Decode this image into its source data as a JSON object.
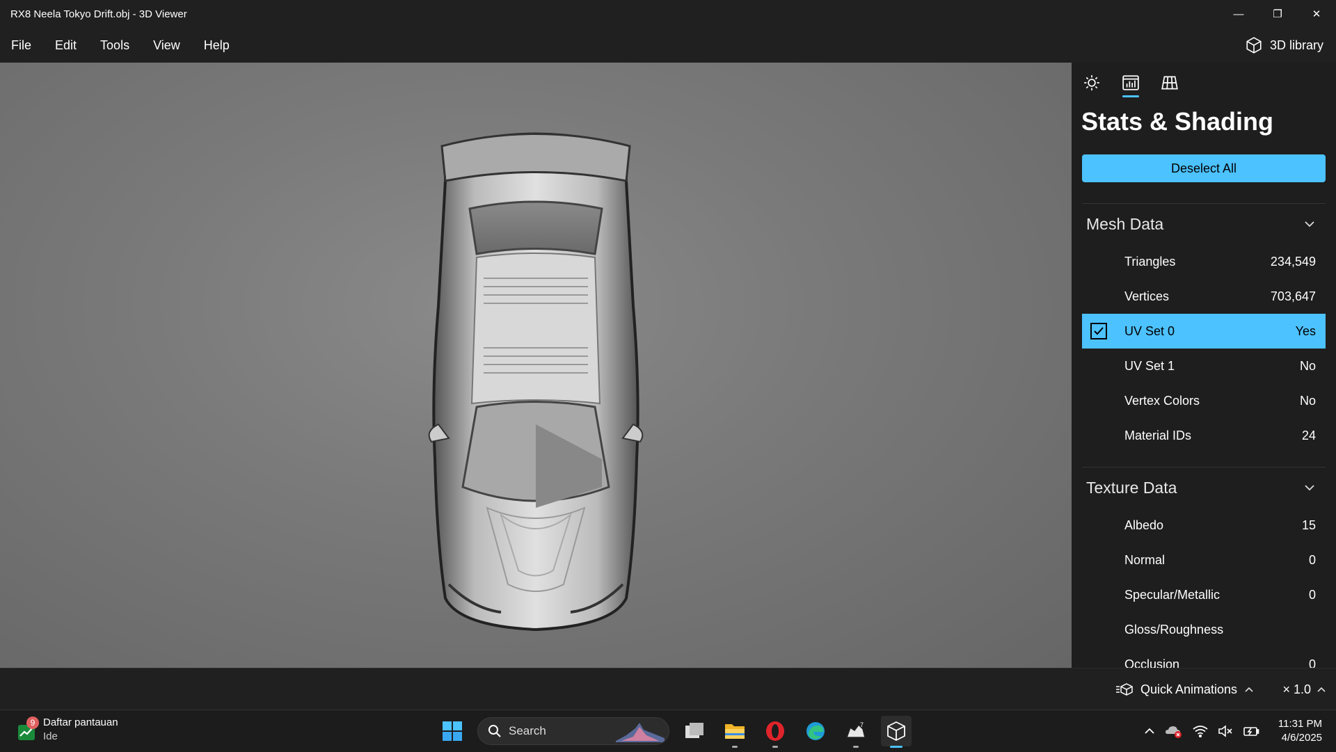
{
  "window": {
    "title": "RX8 Neela Tokyo Drift.obj - 3D Viewer",
    "controls": {
      "minimize": "—",
      "restore": "❐",
      "close": "✕"
    }
  },
  "menu": [
    "File",
    "Edit",
    "Tools",
    "View",
    "Help"
  ],
  "library": {
    "label": "3D library",
    "icon": "cube-library-icon"
  },
  "panel": {
    "tabs": [
      {
        "icon": "sun-icon",
        "active": false
      },
      {
        "icon": "stats-icon",
        "active": true
      },
      {
        "icon": "grid-icon",
        "active": false
      }
    ],
    "title": "Stats & Shading",
    "deselect_label": "Deselect All",
    "mesh": {
      "header": "Mesh Data",
      "rows": [
        {
          "label": "Triangles",
          "value": "234,549"
        },
        {
          "label": "Vertices",
          "value": "703,647"
        },
        {
          "label": "UV Set 0",
          "value": "Yes",
          "selected": true
        },
        {
          "label": "UV Set 1",
          "value": "No"
        },
        {
          "label": "Vertex Colors",
          "value": "No"
        },
        {
          "label": "Material IDs",
          "value": "24"
        }
      ]
    },
    "texture": {
      "header": "Texture Data",
      "rows": [
        {
          "label": "Albedo",
          "value": "15"
        },
        {
          "label": "Normal",
          "value": "0"
        },
        {
          "label": "Specular/Metallic",
          "value": "0"
        },
        {
          "label": "Gloss/Roughness",
          "value": ""
        },
        {
          "label": "Occlusion",
          "value": "0"
        }
      ]
    }
  },
  "bottombar": {
    "quick_animations": "Quick Animations",
    "speed": "× 1.0"
  },
  "taskbar": {
    "widget": {
      "badge": "9",
      "title": "Daftar pantauan",
      "subtitle": "Ide"
    },
    "search_label": "Search",
    "clock": {
      "time": "11:31 PM",
      "date": "4/6/2025"
    }
  },
  "colors": {
    "accent": "#4cc2ff",
    "panel_bg": "#1e1e1e",
    "viewport_bg": "#7a7a7a"
  }
}
